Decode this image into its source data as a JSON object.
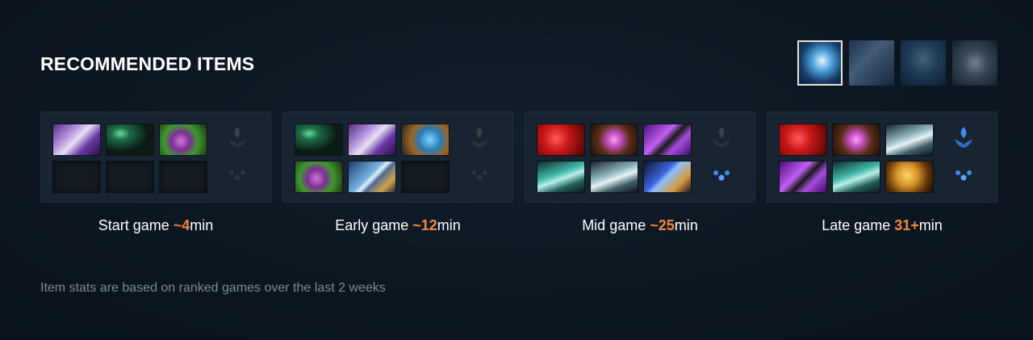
{
  "header": {
    "title": "RECOMMENDED ITEMS"
  },
  "abilities": [
    {
      "name": "ability-1",
      "selected": true
    },
    {
      "name": "ability-2",
      "selected": false
    },
    {
      "name": "ability-3",
      "selected": false
    },
    {
      "name": "ability-4",
      "selected": false
    }
  ],
  "stages": [
    {
      "label": "Start game ",
      "time": "~4",
      "unit": "min",
      "items": [
        "clarity",
        "iron-branch",
        "enchanted-mango",
        "empty",
        "empty",
        "empty"
      ],
      "tier_active": false
    },
    {
      "label": "Early game ",
      "time": "~12",
      "unit": "min",
      "items": [
        "iron-branch",
        "clarity",
        "shield",
        "enchanted-mango",
        "sword",
        "empty"
      ],
      "tier_active": false
    },
    {
      "label": "Mid game ",
      "time": "~25",
      "unit": "min",
      "items": [
        "red-gem",
        "orb",
        "purple-dagger",
        "boots",
        "helm",
        "blue-spear"
      ],
      "tier_active": false,
      "dots_active": true
    },
    {
      "label": "Late game ",
      "time": "31+",
      "unit": "min",
      "items": [
        "red-gem",
        "orb",
        "helm",
        "purple-dagger",
        "boots",
        "gold-helm"
      ],
      "tier_active": true,
      "dots_active": true
    }
  ],
  "colors": {
    "accent": "#f0883e",
    "background": "#0c1620",
    "panel": "#182431",
    "footnote": "#7f8a97"
  },
  "footer": {
    "note": "Item stats are based on ranked games over the last 2 weeks"
  }
}
